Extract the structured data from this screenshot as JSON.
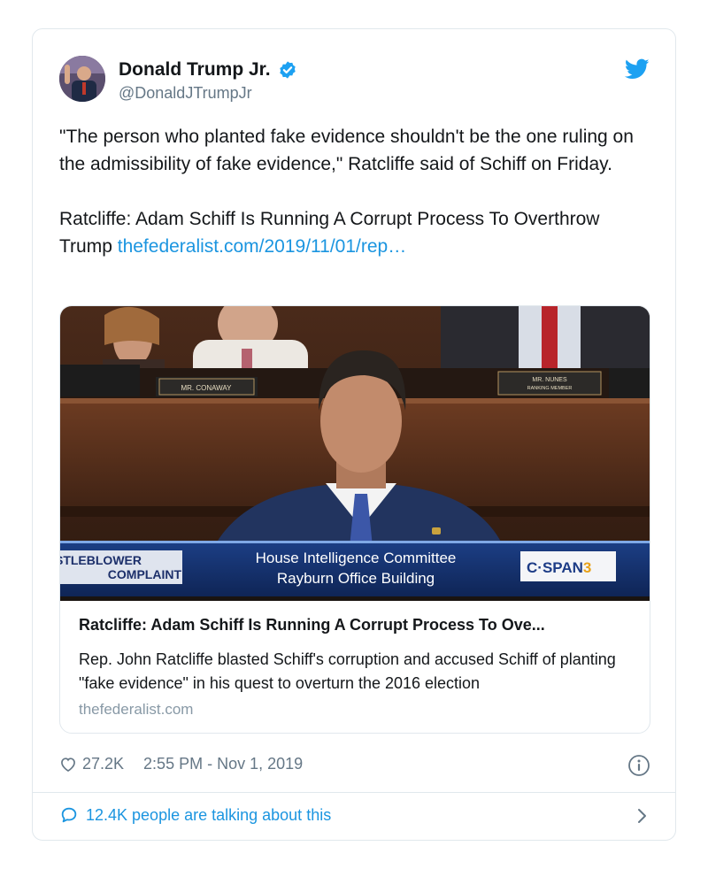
{
  "author": {
    "name": "Donald Trump Jr.",
    "handle": "@DonaldJTrumpJr",
    "verified_icon": "verified-badge-icon"
  },
  "tweet": {
    "paragraph1": "\"The person who planted fake evidence shouldn't be the one ruling on the admissibility of fake evidence,\" Ratcliffe said of Schiff on Friday.",
    "paragraph2_text": "Ratcliffe: Adam Schiff Is Running A Corrupt Process To Overthrow Trump ",
    "paragraph2_link": "thefederalist.com/2019/11/01/rep…"
  },
  "preview": {
    "image": {
      "nameplate_left": "MR. CONAWAY",
      "nameplate_right_line1": "MR. NUNES",
      "nameplate_right_line2": "RANKING MEMBER",
      "chyron_left_line1": "WHISTLEBLOWER",
      "chyron_left_line2": "COMPLAINT",
      "chyron_center_line1": "House Intelligence Committee",
      "chyron_center_line2": "Rayburn Office Building",
      "chyron_logo_text": "C·SPAN",
      "chyron_logo_number": "3"
    },
    "title": "Ratcliffe: Adam Schiff Is Running A Corrupt Process To Ove...",
    "description": "Rep. John Ratcliffe blasted Schiff's corruption and accused Schiff of planting \"fake evidence\" in his quest to overturn the 2016 election",
    "domain": "thefederalist.com"
  },
  "footer": {
    "likes": "27.2K",
    "timestamp": "2:55 PM - Nov 1, 2019",
    "talking": "12.4K people are talking about this"
  },
  "colors": {
    "link": "#1b95e0",
    "secondary_text": "#657786",
    "border": "#e1e8ed",
    "verified": "#1da1f2"
  }
}
